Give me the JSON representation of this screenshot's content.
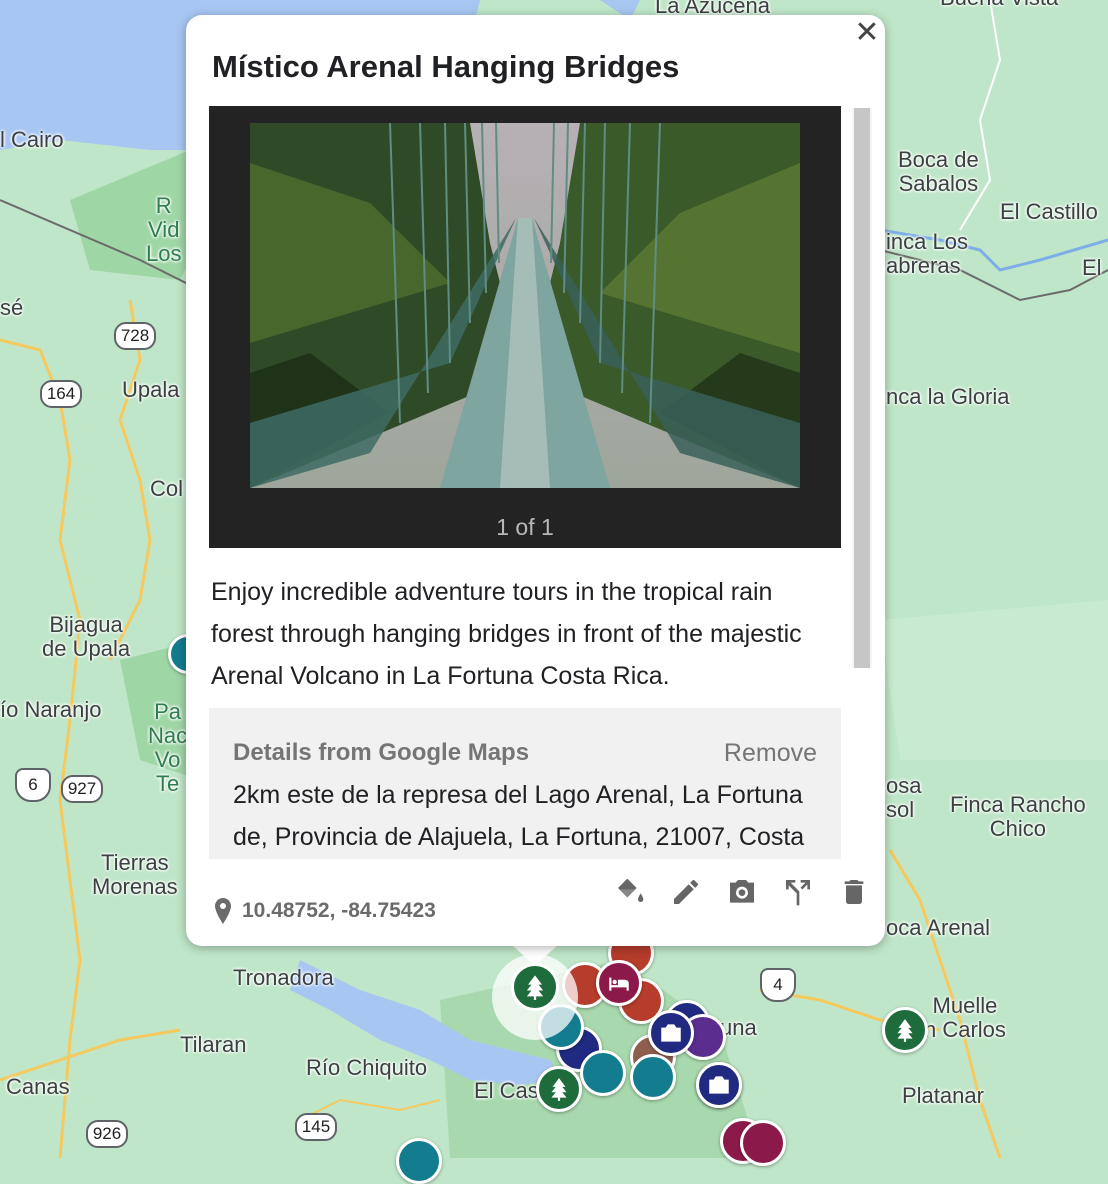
{
  "popup": {
    "title": "Místico Arenal Hanging Bridges",
    "close_icon": "close-icon",
    "photo_counter": "1 of 1",
    "description": "Enjoy incredible adventure tours in the tropical rain forest through hanging bridges in front of the majestic Arenal Volcano in La Fortuna Costa Rica.",
    "details": {
      "title": "Details from Google Maps",
      "remove_label": "Remove",
      "address": "2km este de la represa del Lago Arenal, La Fortuna de, Provincia de Alajuela, La Fortuna, 21007, Costa"
    },
    "coordinates": "10.48752, -84.75423",
    "toolbar": [
      "paint-bucket-icon",
      "pencil-icon",
      "camera-icon",
      "directions-icon",
      "trash-icon"
    ]
  },
  "map": {
    "labels": {
      "la_azucena": "La Azucena",
      "buena_vista": "Buena Vista",
      "el_cairo": "l Cairo",
      "boca_de_sabalos": "Boca de\nSabalos",
      "el_castillo": "El Castillo",
      "finca_los_cabreras": "inca Los\nabreras",
      "el_right": "El",
      "jose": "sé",
      "upala": "Upala",
      "finca_la_gloria": "nca la Gloria",
      "col": "Col",
      "bijagua": "Bijagua\nde Upala",
      "rio_naranjo": "ío Naranjo",
      "tierras_morenas": "Tierras\nMorenas",
      "tronadora": "Tronadora",
      "finca_rancho_chico": "Finca Rancho\nChico",
      "rosa_sol": "osa\nsol",
      "boca_arenal": "oca Arenal",
      "muelle": "Muelle\nn Carlos",
      "platanar": "Platanar",
      "tilaran": "Tilaran",
      "rio_chiquito": "Río Chiquito",
      "canas": "Canas",
      "el_castillo_lower": "El Cas",
      "una": "una",
      "rvl": "R\nVid\nLos",
      "parque": "Pa\nNac\nVo\nTe"
    },
    "shields": {
      "r728": "728",
      "r164": "164",
      "r927": "927",
      "r926": "926",
      "r145": "145",
      "us6": "6",
      "us4": "4"
    },
    "colors": {
      "water": "#a7c6f2",
      "land": "#bfe6c8",
      "park_green": "#1e6b3b",
      "lodging_magenta": "#8b1a4a",
      "camera_navy": "#1f2a80",
      "waterfall_teal": "#137c8e"
    }
  }
}
